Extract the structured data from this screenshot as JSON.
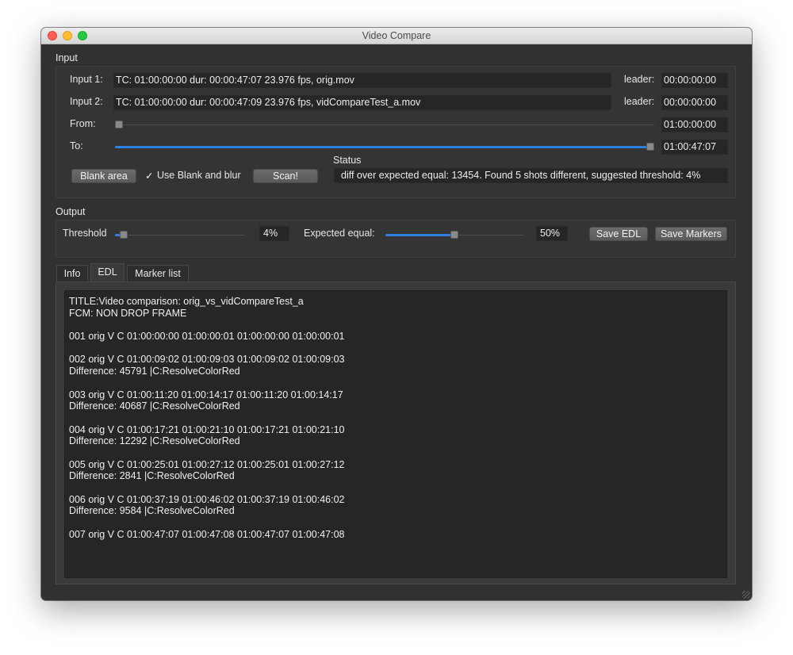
{
  "window": {
    "title": "Video Compare"
  },
  "input": {
    "section_label": "Input",
    "input1_label": "Input 1:",
    "input1_value": "TC: 01:00:00:00  dur:  00:00:47:07  23.976 fps, orig.mov",
    "input1_leader_label": "leader:",
    "input1_leader_value": "00:00:00:00",
    "input2_label": "Input 2:",
    "input2_value": "TC: 01:00:00:00  dur:  00:00:47:09  23.976 fps, vidCompareTest_a.mov",
    "input2_leader_label": "leader:",
    "input2_leader_value": "00:00:00:00",
    "from_label": "From:",
    "from_value": "01:00:00:00",
    "from_slider_fraction": 0.0,
    "to_label": "To:",
    "to_value": "01:00:47:07",
    "to_slider_fraction": 1.0,
    "blank_area_button": "Blank area",
    "use_blank_checkmark": "✓",
    "use_blank_label": "Use Blank and blur",
    "use_blank_checked": true,
    "scan_button": "Scan!",
    "status_label": "Status",
    "status_value": "diff over expected equal: 13454. Found 5 shots different, suggested threshold: 4%"
  },
  "output": {
    "section_label": "Output",
    "threshold_label": "Threshold",
    "threshold_value": "4%",
    "threshold_fraction": 0.04,
    "expected_label": "Expected equal:",
    "expected_value": "50%",
    "expected_fraction": 0.5,
    "save_edl_button": "Save EDL",
    "save_markers_button": "Save Markers"
  },
  "tabs": [
    {
      "label": "Info",
      "active": false
    },
    {
      "label": "EDL",
      "active": true
    },
    {
      "label": "Marker list",
      "active": false
    }
  ],
  "edl_lines": [
    "TITLE:Video comparison: orig_vs_vidCompareTest_a",
    "FCM: NON DROP FRAME",
    "",
    "001 orig V C 01:00:00:00 01:00:00:01 01:00:00:00 01:00:00:01",
    "",
    "002 orig V C 01:00:09:02 01:00:09:03 01:00:09:02 01:00:09:03",
    "Difference: 45791 |C:ResolveColorRed",
    "",
    "003 orig V C 01:00:11:20 01:00:14:17 01:00:11:20 01:00:14:17",
    "Difference: 40687 |C:ResolveColorRed",
    "",
    "004 orig V C 01:00:17:21 01:00:21:10 01:00:17:21 01:00:21:10",
    "Difference: 12292 |C:ResolveColorRed",
    "",
    "005 orig V C 01:00:25:01 01:00:27:12 01:00:25:01 01:00:27:12",
    "Difference: 2841 |C:ResolveColorRed",
    "",
    "006 orig V C 01:00:37:19 01:00:46:02 01:00:37:19 01:00:46:02",
    "Difference: 9584 |C:ResolveColorRed",
    "",
    "007 orig V C 01:00:47:07 01:00:47:08 01:00:47:07 01:00:47:08"
  ],
  "colors": {
    "accent": "#2f7fe0",
    "window_bg": "#313131",
    "field_bg": "#262626",
    "close": "#fe5f57",
    "minimize": "#febc2e",
    "maximize": "#28c840"
  }
}
